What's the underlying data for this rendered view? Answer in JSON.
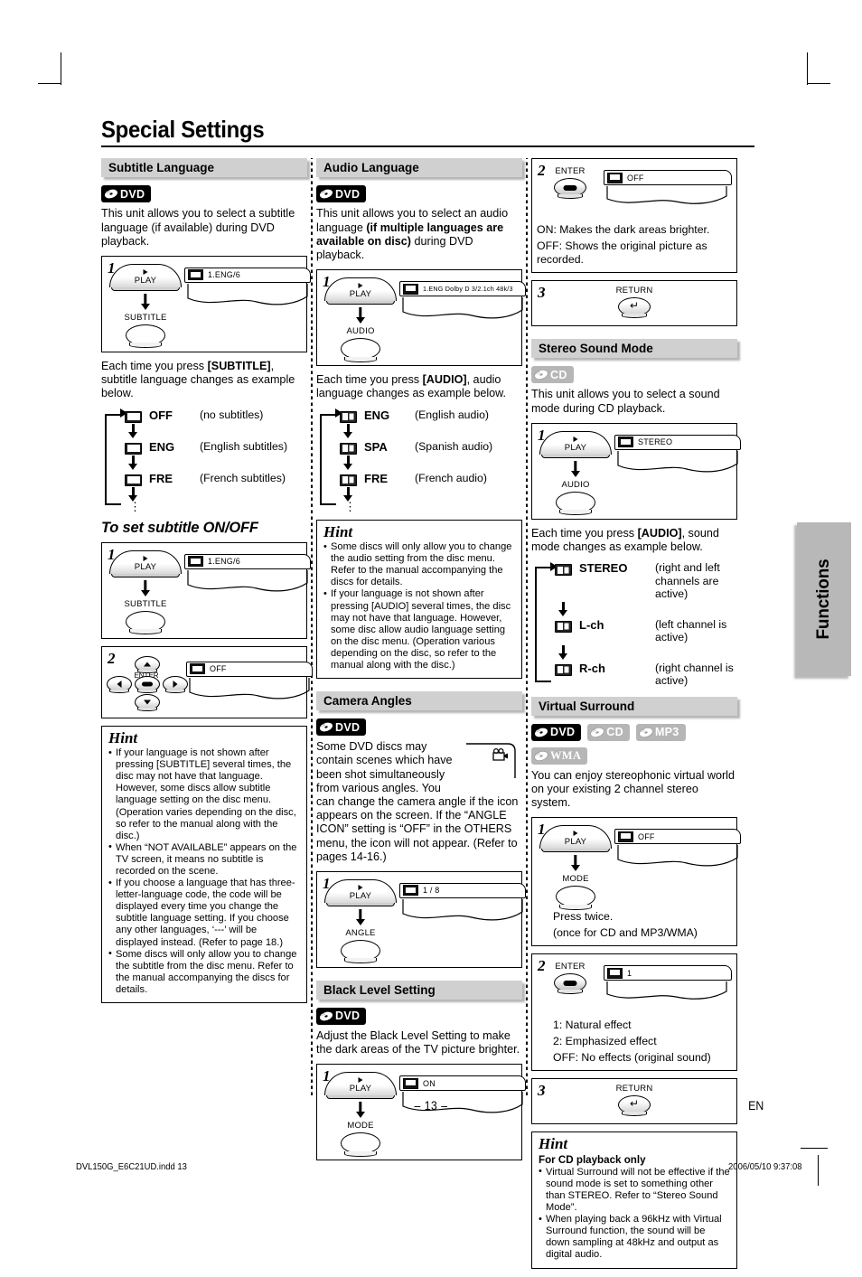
{
  "page": {
    "title": "Special Settings",
    "number": "– 13 –",
    "lang_mark": "EN",
    "side_tab": "Functions",
    "footer_left": "DVL150G_E6C21UD.indd   13",
    "footer_right": "2006/05/10   9:37:08"
  },
  "badges": {
    "dvd": "DVD",
    "cd": "CD",
    "mp3": "MP3",
    "wma": "WMA"
  },
  "subtitle_language": {
    "heading": "Subtitle Language",
    "intro": "This unit allows you to select a subtitle language (if available) during DVD playback.",
    "step1": {
      "num": "1",
      "key_play": "PLAY",
      "key_name": "SUBTITLE",
      "osd_text": "1.ENG/6"
    },
    "cycle_intro_a": "Each time you press ",
    "cycle_intro_b": "[SUBTITLE]",
    "cycle_intro_c": ", subtitle language changes as example below.",
    "cycle": [
      {
        "label": "OFF",
        "desc": "(no subtitles)"
      },
      {
        "label": "ENG",
        "desc": "(English subtitles)"
      },
      {
        "label": "FRE",
        "desc": "(French subtitles)"
      }
    ],
    "onoff_heading": "To set subtitle ON/OFF",
    "onoff_step1": {
      "num": "1",
      "key_play": "PLAY",
      "key_name": "SUBTITLE",
      "osd_text": "1.ENG/6"
    },
    "onoff_step2": {
      "num": "2",
      "key_name": "ENTER",
      "osd_text": "OFF"
    },
    "hint": {
      "title": "Hint",
      "items": [
        "If your language is not shown after pressing [SUBTITLE] several times, the disc may not have that language. However, some discs allow subtitle language setting on the disc menu. (Operation varies depending on the disc, so refer to the manual along with the disc.)",
        "When “NOT AVAILABLE” appears on the TV screen, it means no subtitle is recorded on the scene.",
        "If you choose a language that has three-letter-language code, the code will be displayed every time you change the subtitle language setting. If you choose any other languages, ‘---’ will be displayed instead. (Refer to page 18.)",
        "Some discs will only allow you to change the subtitle from the disc menu. Refer to the manual accompanying the discs for details."
      ]
    }
  },
  "audio_language": {
    "heading": "Audio Language",
    "intro_a": "This unit allows you to select an audio language ",
    "intro_b": "(if multiple languages are available on disc)",
    "intro_c": " during DVD playback.",
    "step1": {
      "num": "1",
      "key_play": "PLAY",
      "key_name": "AUDIO",
      "osd_text": "1.ENG  Dolby D  3/2.1ch  48k/3"
    },
    "cycle_intro_a": "Each time you press ",
    "cycle_intro_b": "[AUDIO]",
    "cycle_intro_c": ", audio language changes as example below.",
    "cycle": [
      {
        "label": "ENG",
        "desc": "(English audio)"
      },
      {
        "label": "SPA",
        "desc": "(Spanish audio)"
      },
      {
        "label": "FRE",
        "desc": "(French audio)"
      }
    ],
    "hint": {
      "title": "Hint",
      "items": [
        "Some discs will only allow you to change the audio setting from the disc menu. Refer to the manual accompanying the discs for details.",
        "If your language is not shown after pressing [AUDIO] several times, the disc may not have that language. However, some disc allow audio language setting on the disc menu. (Operation various depending on the disc, so refer to the manual along with the disc.)"
      ]
    }
  },
  "camera_angles": {
    "heading": "Camera Angles",
    "intro": "Some DVD discs may contain scenes which have been shot simultaneously from various angles. You can change the camera angle if the  icon appears on the screen. If the “ANGLE ICON” setting is “OFF” in the OTHERS menu, the  icon will not appear. (Refer to pages 14-16.)",
    "step1": {
      "num": "1",
      "key_play": "PLAY",
      "key_name": "ANGLE",
      "osd_text": "1 / 8"
    }
  },
  "black_level": {
    "heading": "Black Level Setting",
    "intro": "Adjust the Black Level Setting to make the dark areas of the TV picture brighter.",
    "step1": {
      "num": "1",
      "key_play": "PLAY",
      "key_name": "MODE",
      "osd_text": "ON"
    },
    "step2": {
      "num": "2",
      "key_name": "ENTER",
      "osd_text": "OFF",
      "note_on": "ON: Makes the dark areas brighter.",
      "note_off": "OFF: Shows the original picture as recorded."
    },
    "step3": {
      "num": "3",
      "key_name": "RETURN"
    }
  },
  "stereo_sound_mode": {
    "heading": "Stereo Sound Mode",
    "intro": "This unit allows you to select a sound mode during CD playback.",
    "step1": {
      "num": "1",
      "key_play": "PLAY",
      "key_name": "AUDIO",
      "osd_text": "STEREO"
    },
    "cycle_intro_a": "Each time you press ",
    "cycle_intro_b": "[AUDIO]",
    "cycle_intro_c": ", sound mode changes as example below.",
    "cycle": [
      {
        "label": "STEREO",
        "desc": "(right and left channels are active)"
      },
      {
        "label": "L-ch",
        "desc": "(left channel is active)"
      },
      {
        "label": "R-ch",
        "desc": "(right channel is active)"
      }
    ]
  },
  "virtual_surround": {
    "heading": "Virtual Surround",
    "intro": "You can enjoy stereophonic virtual world on your existing 2 channel stereo system.",
    "step1": {
      "num": "1",
      "key_play": "PLAY",
      "key_name": "MODE",
      "osd_text": "OFF",
      "note1": "Press twice.",
      "note2": "(once for CD and MP3/WMA)"
    },
    "step2": {
      "num": "2",
      "key_name": "ENTER",
      "osd_text": "1",
      "note1": "1: Natural effect",
      "note2": "2: Emphasized effect",
      "note3": "OFF: No effects (original sound)"
    },
    "step3": {
      "num": "3",
      "key_name": "RETURN"
    },
    "hint": {
      "title": "Hint",
      "subtitle": "For CD playback only",
      "items": [
        "Virtual Surround will not be effective if the sound mode is set to something other than STEREO. Refer to “Stereo Sound Mode”.",
        "When playing back a 96kHz with Virtual Surround function, the sound will be down sampling at 48kHz and output as digital audio."
      ]
    }
  }
}
